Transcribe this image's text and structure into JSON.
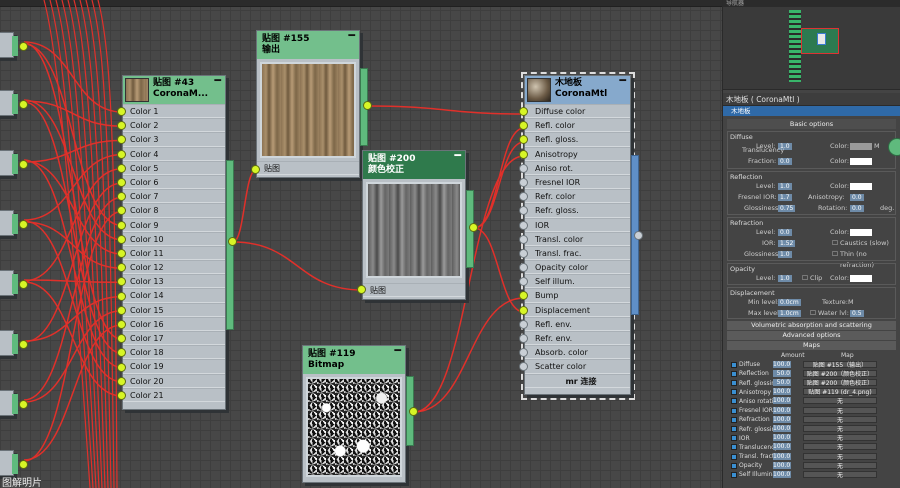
{
  "canvas": {
    "node43": {
      "title": "贴图 #43",
      "subtitle": "CoronaM...",
      "slots": [
        "Color 1",
        "Color 2",
        "Color 3",
        "Color 4",
        "Color 5",
        "Color 6",
        "Color 7",
        "Color 8",
        "Color 9",
        "Color 10",
        "Color 11",
        "Color 12",
        "Color 13",
        "Color 14",
        "Color 15",
        "Color 16",
        "Color 17",
        "Color 18",
        "Color 19",
        "Color 20",
        "Color 21"
      ]
    },
    "node155": {
      "title": "贴图 #155",
      "subtitle": "输出",
      "slot": "贴图"
    },
    "node200": {
      "title": "贴图 #200",
      "subtitle": "颜色校正",
      "slot": "贴图"
    },
    "node119": {
      "title": "贴图 #119",
      "subtitle": "Bitmap"
    },
    "material": {
      "title": "木地板",
      "subtitle": "CoronaMtl",
      "slots": [
        "Diffuse color",
        "Refl. color",
        "Refl. gloss.",
        "Anisotropy",
        "Aniso rot.",
        "Fresnel IOR",
        "Refr. color",
        "Refr. gloss.",
        "IOR",
        "Transl. color",
        "Transl. frac.",
        "Opacity color",
        "Self illum.",
        "Bump",
        "Displacement",
        "Refl. env.",
        "Refr. env.",
        "Absorb. color",
        "Scatter color"
      ],
      "footer": "mr 连接"
    },
    "minimize": "━",
    "colors": {
      "wire": "#e0302a",
      "socket": "#d7f526",
      "header_green": "#73bf8c",
      "header_blue": "#86a9cc"
    }
  },
  "panel": {
    "nav_title": "导航器",
    "material_name": "木地板 ( CoronaMtl )",
    "material_type": "木地板",
    "basic_options": "Basic options",
    "diffuse": {
      "title": "Diffuse",
      "level_label": "Level:",
      "level": "1.0",
      "color_label": "Color:",
      "translucency": "Translucency",
      "fraction_label": "Fraction:",
      "fraction": "0.0",
      "color2_label": "Color:"
    },
    "reflection": {
      "title": "Reflection",
      "level_label": "Level:",
      "level": "1.0",
      "color_label": "Color:",
      "fresnel_label": "Fresnel IOR:",
      "fresnel": "1.7",
      "aniso_label": "Anisotropy:",
      "aniso": "0.0",
      "gloss_label": "Glossiness:",
      "gloss": "0.75",
      "rotation_label": "Rotation:",
      "rotation": "0.0",
      "deg": "deg."
    },
    "refraction": {
      "title": "Refraction",
      "level_label": "Level:",
      "level": "0.0",
      "color_label": "Color:",
      "ior_label": "IOR:",
      "ior": "1.52",
      "caustics": "Caustics (slow)",
      "gloss_label": "Glossiness:",
      "gloss": "1.0",
      "thin": "Thin (no refraction)"
    },
    "opacity": {
      "title": "Opacity",
      "level_label": "Level:",
      "level": "1.0",
      "color_label": "Color:",
      "clip": "Clip"
    },
    "displacement": {
      "title": "Displacement",
      "min_label": "Min level:",
      "min": "0.0cm",
      "texture_label": "Texture:",
      "texture": "M",
      "max_label": "Max level:",
      "max": "1.0cm",
      "water_label": "Water lvl:",
      "water": "0.5"
    },
    "rollout_vol": "Volumetric absorption and scattering",
    "rollout_adv": "Advanced options",
    "rollout_maps": "Maps",
    "maps_header": {
      "amount": "Amount",
      "map": "Map"
    },
    "maps": [
      {
        "name": "Diffuse",
        "amount": "100.0",
        "map": "贴图 #155（输出）"
      },
      {
        "name": "Reflection",
        "amount": "50.0",
        "map": "贴图 #200（颜色校正）"
      },
      {
        "name": "Refl. glossiness",
        "amount": "50.0",
        "map": "贴图 #200（颜色校正）"
      },
      {
        "name": "Anisotropy",
        "amount": "100.0",
        "map": "贴图 #119 (dr_4.png)"
      },
      {
        "name": "Aniso rotation",
        "amount": "100.0",
        "map": "无"
      },
      {
        "name": "Fresnel IOR",
        "amount": "100.0",
        "map": "无"
      },
      {
        "name": "Refraction",
        "amount": "100.0",
        "map": "无"
      },
      {
        "name": "Refr. glossiness",
        "amount": "100.0",
        "map": "无"
      },
      {
        "name": "IOR",
        "amount": "100.0",
        "map": "无"
      },
      {
        "name": "Translucency",
        "amount": "100.0",
        "map": "无"
      },
      {
        "name": "Transl. fraction",
        "amount": "100.0",
        "map": "无"
      },
      {
        "name": "Opacity",
        "amount": "100.0",
        "map": "无"
      },
      {
        "name": "Self Illumination",
        "amount": "100.0",
        "map": "无"
      }
    ]
  },
  "watermark": "图解明片"
}
